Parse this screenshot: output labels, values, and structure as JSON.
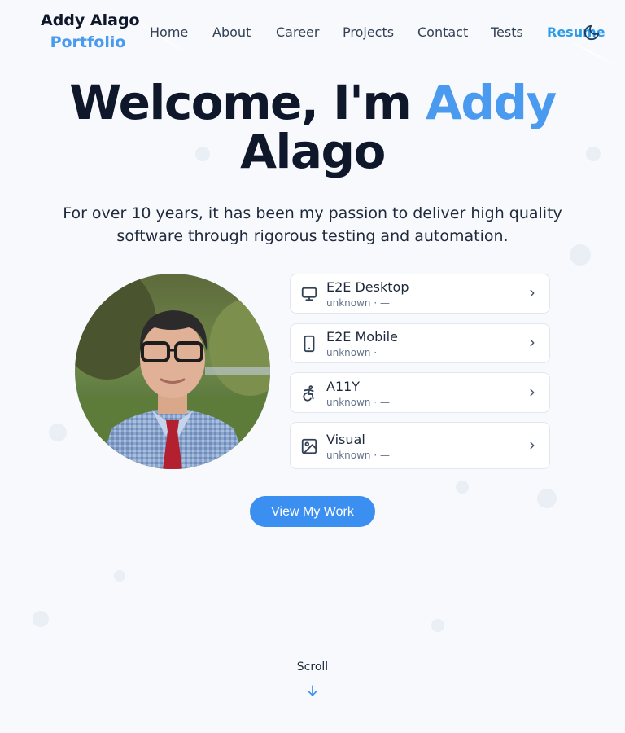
{
  "brand": {
    "name": "Addy Alago",
    "subtitle": "Portfolio"
  },
  "nav": {
    "items": [
      {
        "label": "Home"
      },
      {
        "label": "About"
      },
      {
        "label": "Career"
      },
      {
        "label": "Projects"
      },
      {
        "label": "Contact"
      },
      {
        "label": "Tests"
      },
      {
        "label": "Resume"
      }
    ],
    "active": "Resume",
    "theme_toggle_icon": "moon-icon"
  },
  "hero": {
    "title_prefix": "Welcome, I'm",
    "title_highlight": "Addy",
    "title_suffix": "Alago",
    "subtitle": "For over 10 years, it has been my passion to deliver high quality software through rigorous testing and automation.",
    "cta_label": "View My Work"
  },
  "test_cards": [
    {
      "title": "E2E Desktop",
      "meta": "unknown · —",
      "icon": "monitor-icon"
    },
    {
      "title": "E2E Mobile",
      "meta": "unknown · —",
      "icon": "smartphone-icon"
    },
    {
      "title": "A11Y",
      "meta": "unknown · —",
      "icon": "accessibility-icon"
    },
    {
      "title": "Visual",
      "meta": "unknown · —",
      "icon": "image-icon"
    }
  ],
  "scroll": {
    "label": "Scroll",
    "icon": "arrow-down-icon"
  },
  "colors": {
    "accent": "#4a9bf0",
    "button": "#3b8ff0",
    "active_nav": "#2d9ce8",
    "text": "#0f172a",
    "background": "#f7f9fc"
  }
}
